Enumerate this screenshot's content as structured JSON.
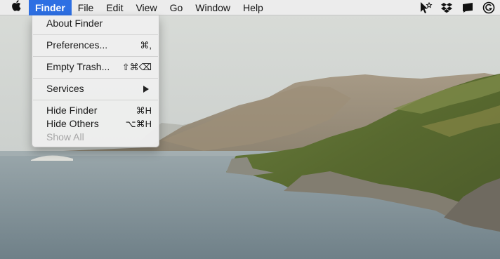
{
  "menubar": {
    "apple_icon": "apple-icon",
    "items": [
      "Finder",
      "File",
      "Edit",
      "View",
      "Go",
      "Window",
      "Help"
    ],
    "active_item": "Finder",
    "status_icons": [
      "cursor-sparkle-icon",
      "dropbox-icon",
      "notification-icon",
      "grammarly-icon"
    ]
  },
  "finder_menu": {
    "about": {
      "label": "About Finder"
    },
    "preferences": {
      "label": "Preferences...",
      "shortcut": "⌘,"
    },
    "empty_trash": {
      "label": "Empty Trash...",
      "shortcut": "⇧⌘⌫"
    },
    "services": {
      "label": "Services",
      "has_submenu": true
    },
    "hide_finder": {
      "label": "Hide Finder",
      "shortcut": "⌘H"
    },
    "hide_others": {
      "label": "Hide Others",
      "shortcut": "⌥⌘H"
    },
    "show_all": {
      "label": "Show All",
      "enabled": false
    }
  },
  "colors": {
    "menubar_bg": "#ececec",
    "accent": "#2d6fe3",
    "disabled_text": "#a5a5a5"
  }
}
